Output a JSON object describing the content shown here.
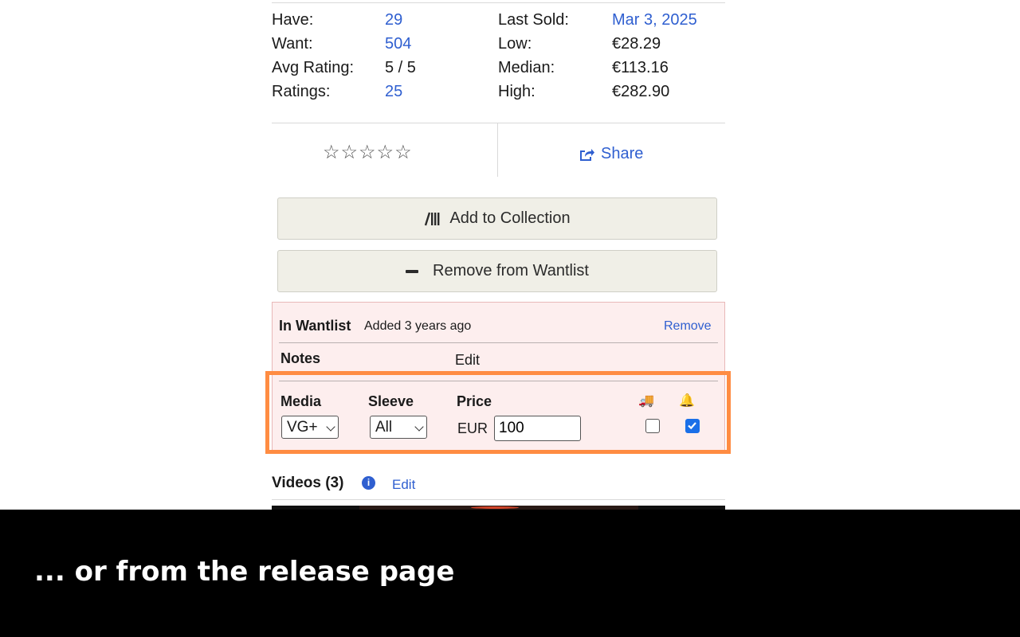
{
  "stats": {
    "left": [
      {
        "label": "Have:",
        "value": "29"
      },
      {
        "label": "Want:",
        "value": "504"
      },
      {
        "label": "Avg Rating:",
        "value": "5 / 5"
      },
      {
        "label": "Ratings:",
        "value": "25"
      }
    ],
    "right": [
      {
        "label": "Last Sold:",
        "value": "Mar 3, 2025"
      },
      {
        "label": "Low:",
        "value": "€28.29"
      },
      {
        "label": "Median:",
        "value": "€113.16"
      },
      {
        "label": "High:",
        "value": "€282.90"
      }
    ]
  },
  "rating": {
    "stars": "☆☆☆☆☆"
  },
  "share": {
    "label": "Share",
    "icon": "share-icon"
  },
  "actions": {
    "add_collection": "Add to Collection",
    "remove_wantlist": "Remove from Wantlist"
  },
  "wantlist": {
    "title": "In Wantlist",
    "added": "Added 3 years ago",
    "remove": "Remove",
    "notes_label": "Notes",
    "notes_edit": "Edit",
    "media_label": "Media",
    "media_value": "VG+",
    "sleeve_label": "Sleeve",
    "sleeve_value": "All",
    "price_label": "Price",
    "currency": "EUR",
    "price_value": "100",
    "shipping_icon": "🚚",
    "notify_icon": "🔔",
    "shipping_checked": false,
    "notify_checked": true
  },
  "videos": {
    "label": "Videos (3)",
    "edit": "Edit"
  },
  "caption": "... or from the release page",
  "colors": {
    "link": "#2f5fd0",
    "highlight": "#ff8c42",
    "wantlist_bg": "#fdeeee"
  }
}
